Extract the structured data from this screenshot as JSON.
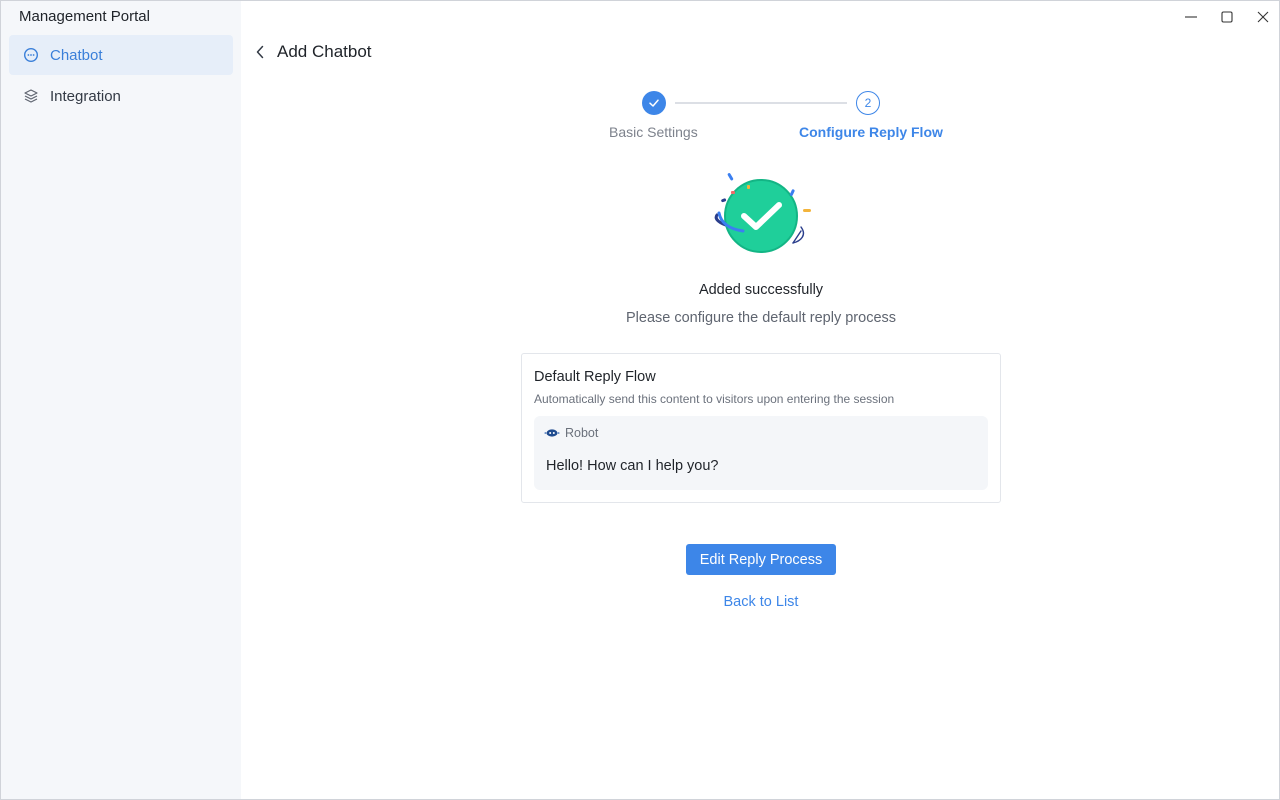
{
  "app": {
    "title": "Management Portal"
  },
  "sidebar": {
    "items": [
      {
        "label": "Chatbot",
        "icon": "chat-bubble-icon",
        "active": true
      },
      {
        "label": "Integration",
        "icon": "layers-icon",
        "active": false
      }
    ]
  },
  "window_controls": {
    "minimize": "minimize-icon",
    "maximize": "maximize-icon",
    "close": "close-icon"
  },
  "header": {
    "title": "Add Chatbot",
    "back_icon": "chevron-left-icon"
  },
  "stepper": {
    "steps": [
      {
        "label": "Basic Settings",
        "status": "completed"
      },
      {
        "label": "Configure Reply Flow",
        "number": "2",
        "status": "current"
      }
    ]
  },
  "result": {
    "title": "Added successfully",
    "subtitle": "Please configure the default reply process"
  },
  "card": {
    "title": "Default Reply Flow",
    "description": "Automatically send this content to visitors upon entering the session",
    "sender": "Robot",
    "message": "Hello! How can I help you?"
  },
  "actions": {
    "primary": "Edit Reply Process",
    "secondary": "Back to List"
  },
  "colors": {
    "accent": "#3d86e8",
    "success": "#1fcf9a",
    "sidebar_bg": "#f5f7fa",
    "active_bg": "#e6eef9"
  }
}
